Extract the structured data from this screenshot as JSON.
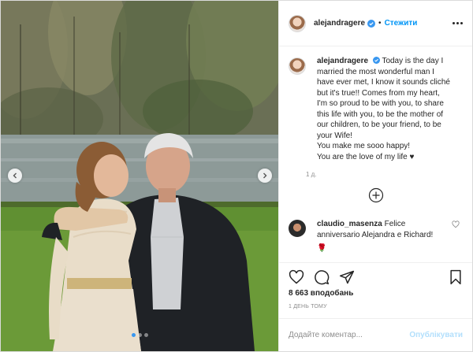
{
  "header": {
    "username": "alejandragere",
    "separator": "•",
    "follow_label": "Стежити"
  },
  "caption": {
    "username": "alejandragere",
    "lines": [
      "Today is the day I",
      "married the most wonderful man I",
      "have ever met, I know it sounds cliché",
      "but it's true!! Comes from my heart,",
      "I'm so proud to be with you, to share",
      "this life with you, to be the mother of",
      "our children, to be your friend, to be",
      "your Wife!",
      "You make me sooo happy!",
      "You are the love of my life ♥"
    ],
    "time": "1 д."
  },
  "comments": [
    {
      "username": "claudio_masenza",
      "text_first": "Felice",
      "text_rest": "anniversario Alejandra e Richard!",
      "emoji": "🌹"
    }
  ],
  "likes": "8 663 вподобань",
  "date": "1 ДЕНЬ ТОМУ",
  "comment_input": {
    "placeholder": "Додайте коментар..."
  },
  "publish_label": "Опублікувати",
  "carousel": {
    "total": 3,
    "active_index": 0
  },
  "icons": {
    "verified": "verified-badge-icon",
    "more": "more-options-icon",
    "load_more": "plus-circle-icon",
    "like": "heart-icon",
    "comment": "comment-icon",
    "share": "paper-plane-icon",
    "save": "bookmark-icon"
  },
  "colors": {
    "accent": "#0095f6",
    "verified": "#3897f0",
    "publish_disabled": "#b2dffc",
    "muted": "#8e8e8e"
  }
}
